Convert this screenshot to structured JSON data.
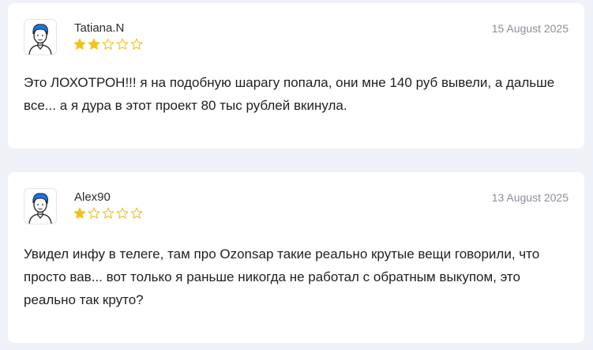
{
  "reviews": [
    {
      "author": "Tatiana.N",
      "date": "15 August 2025",
      "rating": 2,
      "max_rating": 5,
      "avatar_icon": "user-avatar-icon",
      "text": "Это ЛОХОТРОН!!! я на подобную шарагу попала, они мне 140 руб вывели, а дальше все... а я дура в этот проект 80 тыс рублей вкинула."
    },
    {
      "author": "Alex90",
      "date": "13 August 2025",
      "rating": 1,
      "max_rating": 5,
      "avatar_icon": "user-avatar-icon",
      "text": "Увидел инфу в телеге, там про Ozonsap такие реально крутые вещи говорили, что просто вав... вот только я раньше никогда не работал с обратным выкупом, это реально так круто?"
    }
  ],
  "colors": {
    "page_background": "#eef1f8",
    "card_background": "#ffffff",
    "star_filled": "#f2c21c",
    "star_empty_outline": "#f2c21c",
    "date_text": "#8a8f98",
    "avatar_hair": "#1a73e8"
  }
}
